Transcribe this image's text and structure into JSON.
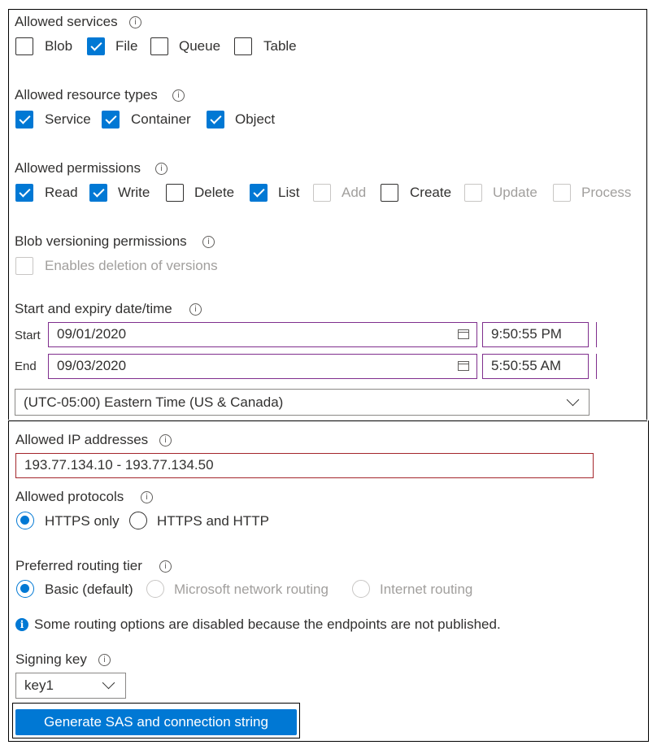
{
  "allowed_services": {
    "title": "Allowed services",
    "items": [
      {
        "label": "Blob",
        "checked": false
      },
      {
        "label": "File",
        "checked": true
      },
      {
        "label": "Queue",
        "checked": false
      },
      {
        "label": "Table",
        "checked": false
      }
    ]
  },
  "allowed_resource_types": {
    "title": "Allowed resource types",
    "items": [
      {
        "label": "Service",
        "checked": true
      },
      {
        "label": "Container",
        "checked": true
      },
      {
        "label": "Object",
        "checked": true
      }
    ]
  },
  "allowed_permissions": {
    "title": "Allowed permissions",
    "items": [
      {
        "label": "Read",
        "checked": true
      },
      {
        "label": "Write",
        "checked": true
      },
      {
        "label": "Delete",
        "checked": false
      },
      {
        "label": "List",
        "checked": true
      },
      {
        "label": "Add",
        "checked": false,
        "disabled": true
      },
      {
        "label": "Create",
        "checked": false
      },
      {
        "label": "Update",
        "checked": false,
        "disabled": true
      },
      {
        "label": "Process",
        "checked": false,
        "disabled": true
      }
    ]
  },
  "blob_versioning": {
    "title": "Blob versioning permissions",
    "option": "Enables deletion of versions"
  },
  "date_time": {
    "title": "Start and expiry date/time",
    "start_label": "Start",
    "start_date": "09/01/2020",
    "start_time": "9:50:55 PM",
    "end_label": "End",
    "end_date": "09/03/2020",
    "end_time": "5:50:55 AM",
    "timezone": "(UTC-05:00) Eastern Time (US & Canada)"
  },
  "allowed_ip": {
    "title": "Allowed IP addresses",
    "value": "193.77.134.10 - 193.77.134.50"
  },
  "allowed_protocols": {
    "title": "Allowed protocols",
    "options": [
      {
        "label": "HTTPS only",
        "selected": true
      },
      {
        "label": "HTTPS and HTTP",
        "selected": false
      }
    ]
  },
  "routing_tier": {
    "title": "Preferred routing tier",
    "options": [
      {
        "label": "Basic (default)",
        "selected": true
      },
      {
        "label": "Microsoft network routing",
        "selected": false,
        "disabled": true
      },
      {
        "label": "Internet routing",
        "selected": false,
        "disabled": true
      }
    ],
    "note": "Some routing options are disabled because the endpoints are not published."
  },
  "signing_key": {
    "title": "Signing key",
    "value": "key1"
  },
  "generate_button": "Generate SAS and connection string",
  "colors": {
    "accent": "#0078d4",
    "disabled": "#a19f9d",
    "date_border": "#7f2e8d",
    "ip_border": "#a4262c"
  }
}
